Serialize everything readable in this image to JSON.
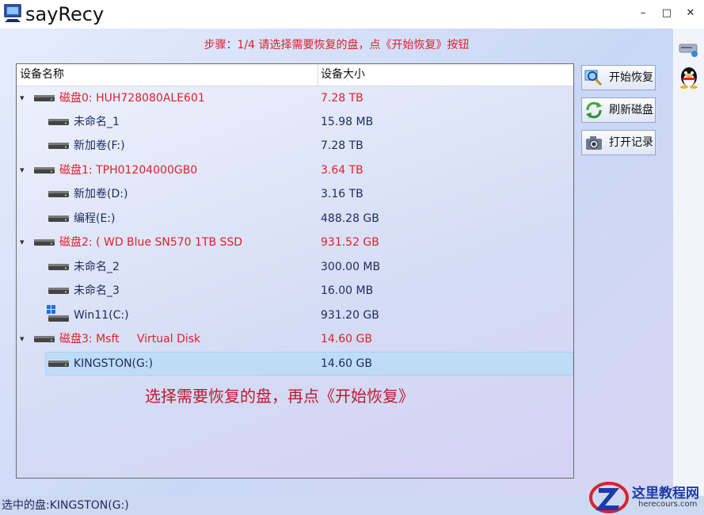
{
  "window": {
    "title": "sayRecy",
    "controls": {
      "minimize": "–",
      "maximize": "□",
      "close": "✕"
    }
  },
  "step_text": "步骤：1/4 请选择需要恢复的盘，点《开始恢复》按钮",
  "tree": {
    "columns": {
      "name": "设备名称",
      "size": "设备大小"
    },
    "rows": [
      {
        "type": "disk",
        "name": "磁盘0: HUH728080ALE601",
        "size": "7.28 TB"
      },
      {
        "type": "part",
        "name": "未命名_1",
        "size": "15.98 MB"
      },
      {
        "type": "part",
        "name": "新加卷(F:)",
        "size": "7.28 TB"
      },
      {
        "type": "disk",
        "name": "磁盘1: TPH01204000GB0",
        "size": "3.64 TB"
      },
      {
        "type": "part",
        "name": "新加卷(D:)",
        "size": "3.16 TB"
      },
      {
        "type": "part",
        "name": "编程(E:)",
        "size": "488.28 GB"
      },
      {
        "type": "disk",
        "name": "磁盘2: ( WD Blue SN570 1TB SSD",
        "size": "931.52 GB"
      },
      {
        "type": "part",
        "name": "未命名_2",
        "size": "300.00 MB"
      },
      {
        "type": "part",
        "name": "未命名_3",
        "size": "16.00 MB"
      },
      {
        "type": "part",
        "name": "Win11(C:)",
        "size": "931.20 GB",
        "icon": "windows-icon"
      },
      {
        "type": "disk",
        "name": "磁盘3: Msft     Virtual Disk",
        "size": "14.60 GB"
      },
      {
        "type": "part",
        "name": "KINGSTON(G:)",
        "size": "14.60 GB",
        "selected": true
      }
    ]
  },
  "hint_text": "选择需要恢复的盘，再点《开始恢复》",
  "buttons": {
    "start": "开始恢复",
    "refresh": "刷新磁盘",
    "log": "打开记录"
  },
  "status": "选中的盘:KINGSTON(G:)",
  "watermark": {
    "main": "这里教程网",
    "sub": "herecours.com"
  },
  "colors": {
    "disk_text": "#e0202a",
    "part_text": "#1c2a5a",
    "hint": "#c0182c",
    "selection": "#bfdcf7"
  }
}
